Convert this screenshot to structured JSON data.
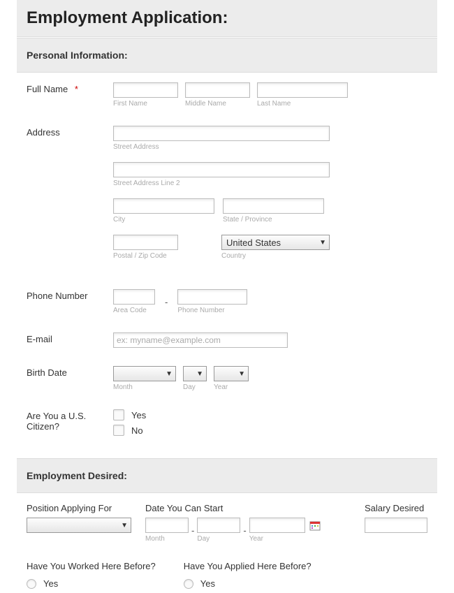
{
  "title": "Employment Application:",
  "sections": {
    "personal": {
      "header": "Personal Information:",
      "fullName": {
        "label": "Full Name",
        "required": "*",
        "first": {
          "sub": "First Name"
        },
        "middle": {
          "sub": "Middle Name"
        },
        "last": {
          "sub": "Last Name"
        }
      },
      "address": {
        "label": "Address",
        "street1": {
          "sub": "Street Address"
        },
        "street2": {
          "sub": "Street Address Line 2"
        },
        "city": {
          "sub": "City"
        },
        "state": {
          "sub": "State / Province"
        },
        "postal": {
          "sub": "Postal / Zip Code"
        },
        "country": {
          "sub": "Country",
          "value": "United States"
        }
      },
      "phone": {
        "label": "Phone Number",
        "area": {
          "sub": "Area Code"
        },
        "number": {
          "sub": "Phone Number"
        },
        "sep": "-"
      },
      "email": {
        "label": "E-mail",
        "placeholder": "ex: myname@example.com"
      },
      "birth": {
        "label": "Birth Date",
        "month": {
          "sub": "Month"
        },
        "day": {
          "sub": "Day"
        },
        "year": {
          "sub": "Year"
        }
      },
      "citizen": {
        "label": "Are You a U.S. Citizen?",
        "yes": "Yes",
        "no": "No"
      }
    },
    "employment": {
      "header": "Employment Desired:",
      "position": {
        "label": "Position Applying For"
      },
      "startDate": {
        "label": "Date You Can Start",
        "month": {
          "sub": "Month"
        },
        "day": {
          "sub": "Day"
        },
        "year": {
          "sub": "Year"
        },
        "sep": "-"
      },
      "salary": {
        "label": "Salary Desired"
      },
      "workedBefore": {
        "label": "Have You Worked Here Before?",
        "yes": "Yes"
      },
      "appliedBefore": {
        "label": "Have You Applied Here Before?",
        "yes": "Yes"
      }
    }
  }
}
